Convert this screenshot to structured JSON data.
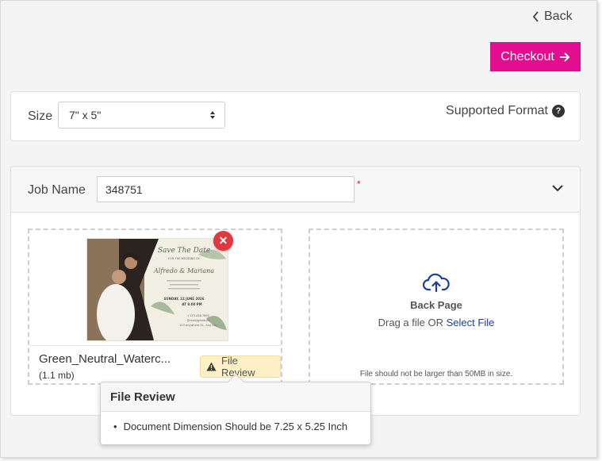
{
  "header": {
    "back_label": "Back",
    "checkout_label": "Checkout",
    "accent_color": "#e20d8f"
  },
  "size_panel": {
    "label": "Size",
    "selected": "7\" x 5\"",
    "supported_label": "Supported Format",
    "help_icon": "question-circle-icon"
  },
  "job": {
    "label": "Job Name",
    "value": "348751",
    "required_mark": "*"
  },
  "front": {
    "file_name": "Green_Neutral_Waterc...",
    "file_size": "(1.1 mb)",
    "review_label": "File Review",
    "thumbnail": {
      "line1": "Save The Date",
      "line2": "FOR THE WEDDING OF",
      "names": "Alfredo & Mariana",
      "date": "SUNDAY, 22 JUNE 2026",
      "time": "AT 8:00 PM",
      "phone": "+123-456-7890",
      "handle": "@reallygreatsite",
      "address": "123 Anywhere St., Any City"
    }
  },
  "back_page": {
    "title": "Back Page",
    "drag_text": "Drag a file OR",
    "select_label": "Select File",
    "limit_text": "File should not be larger than 50MB in size."
  },
  "tooltip": {
    "title": "File Review",
    "items": [
      "Document Dimension Should be 7.25 x 5.25 Inch"
    ]
  }
}
